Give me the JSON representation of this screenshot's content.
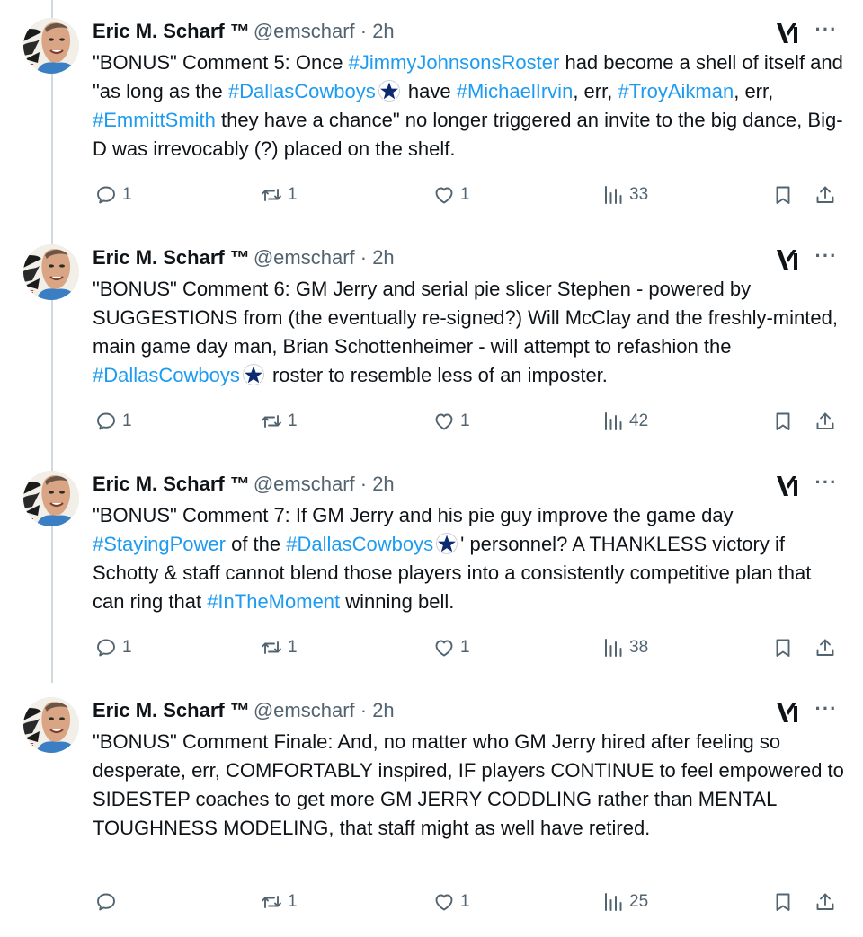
{
  "colors": {
    "link": "#1d9bf0",
    "muted": "#536471",
    "text": "#0f1419",
    "thread_line": "#cfd9de"
  },
  "icons": [
    "grok-icon",
    "more-icon",
    "reply-icon",
    "retweet-icon",
    "like-icon",
    "views-icon",
    "bookmark-icon",
    "share-icon",
    "star-icon"
  ],
  "tweets": [
    {
      "name": "Eric M. Scharf ™",
      "handle": "@emscharf · 2h",
      "text": [
        "\"BONUS\" Comment 5: Once ",
        "#JimmyJohnsonsRoster",
        " had become a shell of itself and \"as long as the ",
        "#DallasCowboys",
        " have ",
        "#MichaelIrvin",
        ", err, ",
        "#TroyAikman",
        ", err, ",
        "#EmmittSmith",
        " they have a chance\" no longer triggered an invite to the big dance, Big-D was irrevocably (?) placed on the shelf."
      ],
      "replies": "1",
      "reposts": "1",
      "likes": "1",
      "views": "33"
    },
    {
      "name": "Eric M. Scharf ™",
      "handle": "@emscharf · 2h",
      "text": [
        "\"BONUS\" Comment 6: GM Jerry and serial pie slicer Stephen - powered by SUGGESTIONS from (the eventually re-signed?) Will McClay and the freshly-minted, main game day man, Brian Schottenheimer - will attempt to refashion the ",
        "#DallasCowboys",
        " roster to resemble less of an imposter."
      ],
      "replies": "1",
      "reposts": "1",
      "likes": "1",
      "views": "42"
    },
    {
      "name": "Eric M. Scharf ™",
      "handle": "@emscharf · 2h",
      "text": [
        "\"BONUS\" Comment 7: If GM Jerry and his pie guy improve the game day ",
        "#StayingPower",
        " of the ",
        "#DallasCowboys",
        "' personnel? A THANKLESS victory if Schotty & staff cannot blend those players into a consistently competitive plan that can ring that ",
        "#InTheMoment",
        " winning bell."
      ],
      "replies": "1",
      "reposts": "1",
      "likes": "1",
      "views": "38"
    },
    {
      "name": "Eric M. Scharf ™",
      "handle": "@emscharf · 2h",
      "text": [
        "\"BONUS\" Comment Finale: And, no matter who GM Jerry hired after feeling so desperate, err, COMFORTABLY inspired, IF players CONTINUE to feel empowered to SIDESTEP coaches to get more GM JERRY CODDLING rather than MENTAL TOUGHNESS MODELING, that staff might as well have retired."
      ],
      "replies": "",
      "reposts": "1",
      "likes": "1",
      "views": "25"
    }
  ]
}
